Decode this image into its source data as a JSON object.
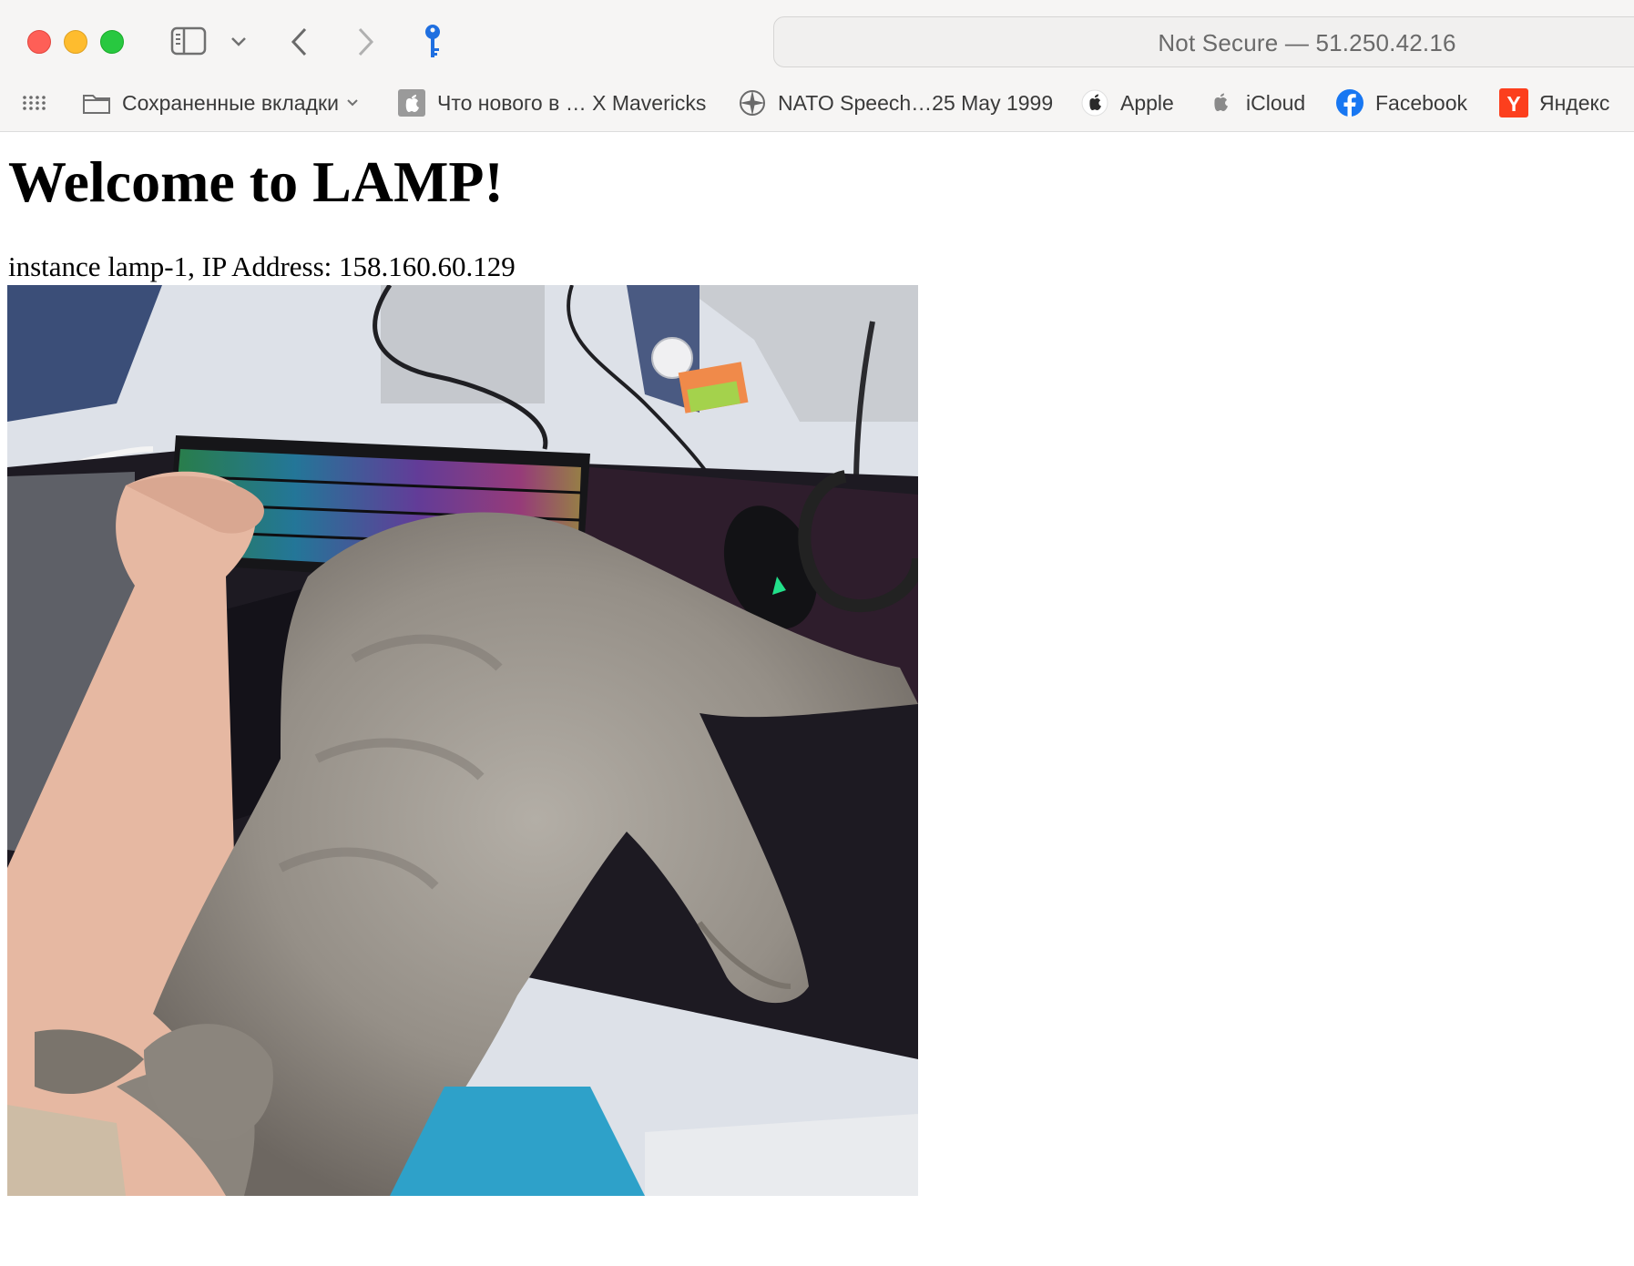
{
  "browser": {
    "address": "Not Secure — 51.250.42.16",
    "bookmarks": [
      {
        "label": "Сохраненные вкладки",
        "icon": "folder-icon"
      },
      {
        "label": "Что нового в … X Mavericks",
        "icon": "apple-icon"
      },
      {
        "label": "NATO Speech…25 May 1999",
        "icon": "compass-icon"
      },
      {
        "label": "Apple",
        "icon": "apple-icon"
      },
      {
        "label": "iCloud",
        "icon": "apple-icon"
      },
      {
        "label": "Facebook",
        "icon": "facebook-icon"
      },
      {
        "label": "Яндекс",
        "icon": "yandex-icon"
      }
    ],
    "colors": {
      "close": "#fe5f57",
      "minimize": "#febc2e",
      "maximize": "#28c840",
      "key": "#1f6fe0"
    }
  },
  "page": {
    "heading": "Welcome to LAMP!",
    "info": "instance lamp-1, IP Address: 158.160.60.129",
    "image_description": "photo"
  }
}
